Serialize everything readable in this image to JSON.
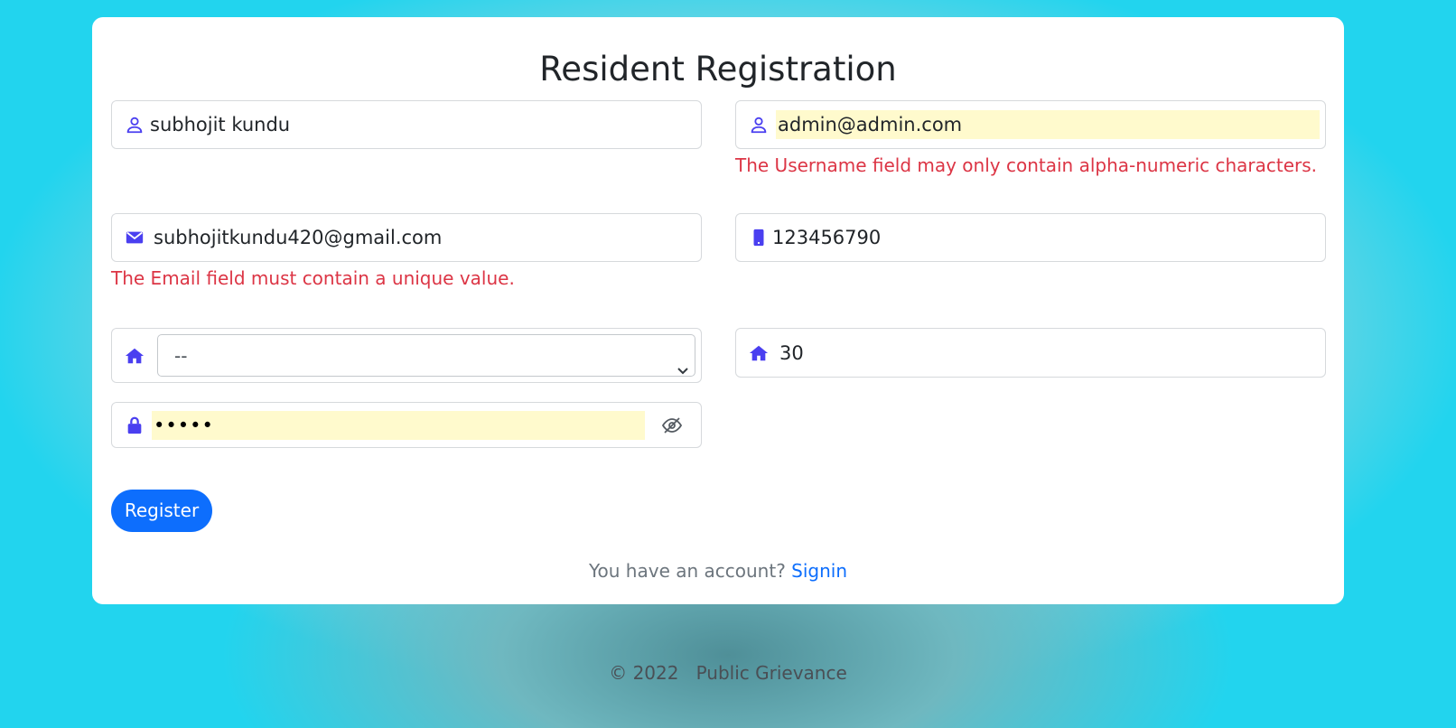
{
  "form": {
    "title": "Resident Registration",
    "name_value": "subhojit kundu",
    "username_value": "admin@admin.com",
    "username_error": "The Username field may only contain alpha-numeric characters.",
    "email_value": "subhojitkundu420@gmail.com",
    "email_error": "The Email field must contain a unique value.",
    "phone_value": "123456790",
    "ward_select_value": "--",
    "house_value": "30",
    "password_value": "•••••",
    "register_label": "Register",
    "account_prompt": "You have an account?",
    "signin_label": "Signin"
  },
  "footer": {
    "copyright": "© 2022",
    "site_name": "Public Grievance"
  },
  "colors": {
    "icon": "#4a3ff0",
    "error": "#dc3545",
    "primary": "#0d6efd",
    "autofill": "#fffacd"
  },
  "icons": [
    "user-icon",
    "envelope-icon",
    "mobile-icon",
    "home-icon",
    "lock-icon",
    "eye-slash-icon",
    "chevron-down-icon"
  ]
}
